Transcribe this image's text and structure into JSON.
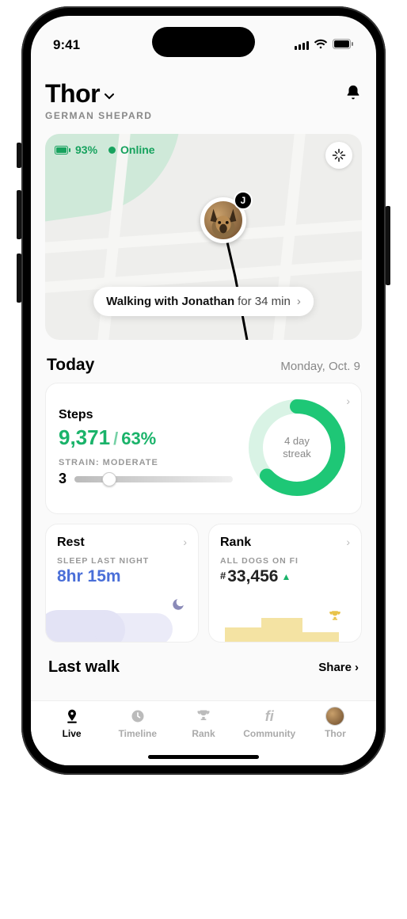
{
  "status": {
    "time": "9:41"
  },
  "header": {
    "name": "Thor",
    "breed": "GERMAN SHEPARD"
  },
  "map": {
    "battery": "93%",
    "status": "Online",
    "avatar_badge": "J",
    "walk_prefix": "Walking with Jonathan",
    "walk_suffix": "for 34 min"
  },
  "today": {
    "title": "Today",
    "date": "Monday, Oct. 9"
  },
  "steps": {
    "title": "Steps",
    "value": "9,371",
    "percent": "63%",
    "strain_label": "STRAIN: MODERATE",
    "strain_value": "3",
    "strain_slider_pct": 22,
    "ring_percent": 63,
    "streak_line1": "4 day",
    "streak_line2": "streak"
  },
  "rest": {
    "title": "Rest",
    "sub": "SLEEP LAST NIGHT",
    "value": "8hr 15m"
  },
  "rank": {
    "title": "Rank",
    "sub": "ALL DOGS ON FI",
    "value": "33,456"
  },
  "lastwalk": {
    "title": "Last walk",
    "share": "Share"
  },
  "tabs": {
    "live": "Live",
    "timeline": "Timeline",
    "rank": "Rank",
    "community": "Community",
    "pet": "Thor"
  }
}
